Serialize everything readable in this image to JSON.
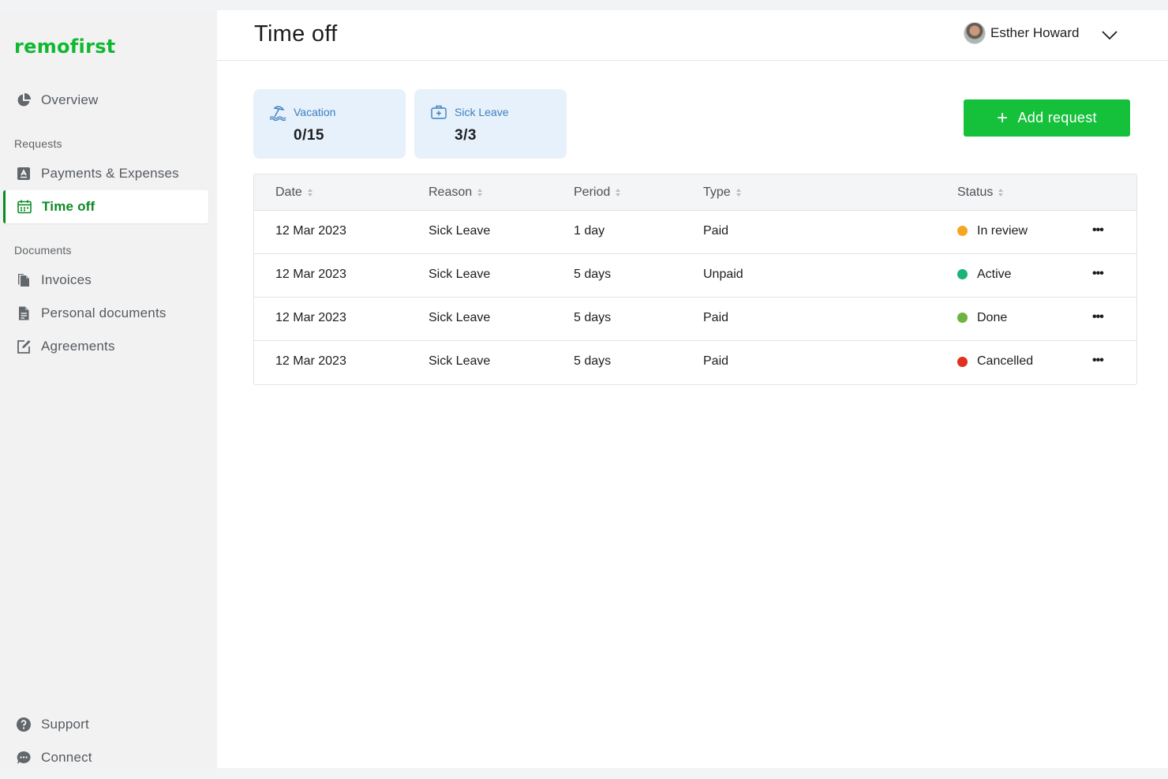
{
  "app": {
    "logo_text": "remofirst",
    "brand_color": "#10b830"
  },
  "sidebar": {
    "overview": {
      "label": "Overview",
      "icon": "pie-chart-icon"
    },
    "requests_section": "Requests",
    "payments": {
      "label": "Payments & Expenses",
      "icon": "receipt-icon"
    },
    "time_off": {
      "label": "Time off",
      "icon": "calendar-icon"
    },
    "documents_section": "Documents",
    "invoices": {
      "label": "Invoices",
      "icon": "files-icon"
    },
    "personal_documents": {
      "label": "Personal documents",
      "icon": "document-icon"
    },
    "agreements": {
      "label": "Agreements",
      "icon": "edit-icon"
    },
    "support": {
      "label": "Support",
      "icon": "help-icon"
    },
    "connect": {
      "label": "Connect",
      "icon": "chat-icon"
    }
  },
  "header": {
    "title": "Time off",
    "user_name": "Esther Howard"
  },
  "balances": [
    {
      "label": "Vacation",
      "value": "0/15",
      "icon": "beach-umbrella-icon"
    },
    {
      "label": "Sick Leave",
      "value": "3/3",
      "icon": "medical-kit-icon"
    }
  ],
  "actions": {
    "add_request": "Add request"
  },
  "table": {
    "columns": [
      "Date",
      "Reason",
      "Period",
      "Type",
      "Status"
    ],
    "rows": [
      {
        "date": "12 Mar 2023",
        "reason": "Sick Leave",
        "period": "1 day",
        "type": "Paid",
        "status": "In review",
        "status_color": "#f5a623"
      },
      {
        "date": "12 Mar 2023",
        "reason": "Sick Leave",
        "period": "5 days",
        "type": "Unpaid",
        "status": "Active",
        "status_color": "#1bb37a"
      },
      {
        "date": "12 Mar 2023",
        "reason": "Sick Leave",
        "period": "5 days",
        "type": "Paid",
        "status": "Done",
        "status_color": "#6db33f"
      },
      {
        "date": "12 Mar 2023",
        "reason": "Sick Leave",
        "period": "5 days",
        "type": "Paid",
        "status": "Cancelled",
        "status_color": "#e0301e"
      }
    ],
    "more_label": "•••"
  }
}
